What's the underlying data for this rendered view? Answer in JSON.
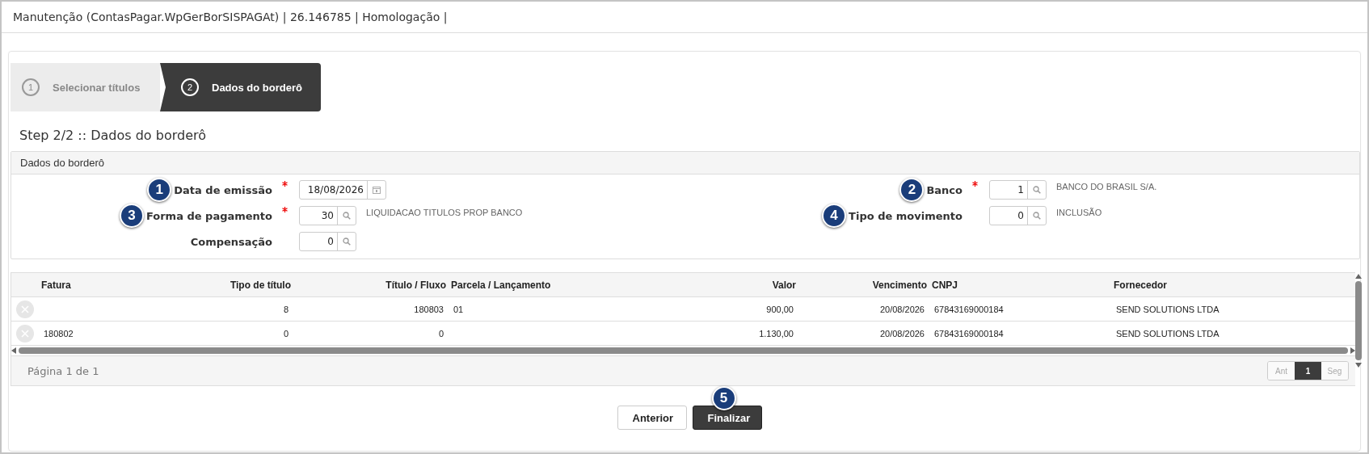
{
  "window": {
    "title": "Manutenção (ContasPagar.WpGerBorSISPAGAt) | 26.146785 | Homologação |"
  },
  "steps": [
    {
      "number": "1",
      "label": "Selecionar títulos",
      "selected": false
    },
    {
      "number": "2",
      "label": "Dados do borderô",
      "selected": true
    }
  ],
  "heading": "Step 2/2 :: Dados do borderô",
  "section": {
    "title": "Dados do borderô",
    "left_fields": [
      {
        "callout": "1",
        "label": "Data de emissão",
        "required": true,
        "value": "18/08/2026",
        "kind": "calendar"
      },
      {
        "callout": "3",
        "label": "Forma de pagamento",
        "required": true,
        "value": "30",
        "kind": "search",
        "description": "LIQUIDACAO TITULOS PROP BANCO"
      },
      {
        "label": "Compensação",
        "required": false,
        "value": "0",
        "kind": "search"
      }
    ],
    "right_fields": [
      {
        "callout": "2",
        "label": "Banco",
        "required": true,
        "value": "1",
        "kind": "search",
        "description": "BANCO DO BRASIL S/A."
      },
      {
        "callout": "4",
        "label": "Tipo de movimento",
        "required": false,
        "value": "0",
        "kind": "search",
        "description": "INCLUSÃO"
      }
    ]
  },
  "table": {
    "columns": [
      "Fatura",
      "Tipo de título",
      "Título / Fluxo",
      "Parcela / Lançamento",
      "Valor",
      "Vencimento",
      "CNPJ",
      "Fornecedor"
    ],
    "rows": [
      {
        "cells": [
          "",
          "8",
          "180803",
          "01",
          "900,00",
          "20/08/2026",
          "67843169000184",
          "SEND SOLUTIONS LTDA"
        ]
      },
      {
        "cells": [
          "180802",
          "0",
          "0",
          "",
          "1.130,00",
          "20/08/2026",
          "67843169000184",
          "SEND SOLUTIONS LTDA"
        ]
      }
    ]
  },
  "pager": {
    "text": "Página 1 de 1",
    "buttons": [
      {
        "label": "Ant",
        "selected": false,
        "disabled": true
      },
      {
        "label": "1",
        "selected": true,
        "disabled": false
      },
      {
        "label": "Seg",
        "selected": false,
        "disabled": true
      }
    ]
  },
  "actions": [
    {
      "label": "Anterior",
      "kind": "secondary"
    },
    {
      "label": "Finalizar",
      "kind": "primary",
      "callout": "5"
    }
  ]
}
